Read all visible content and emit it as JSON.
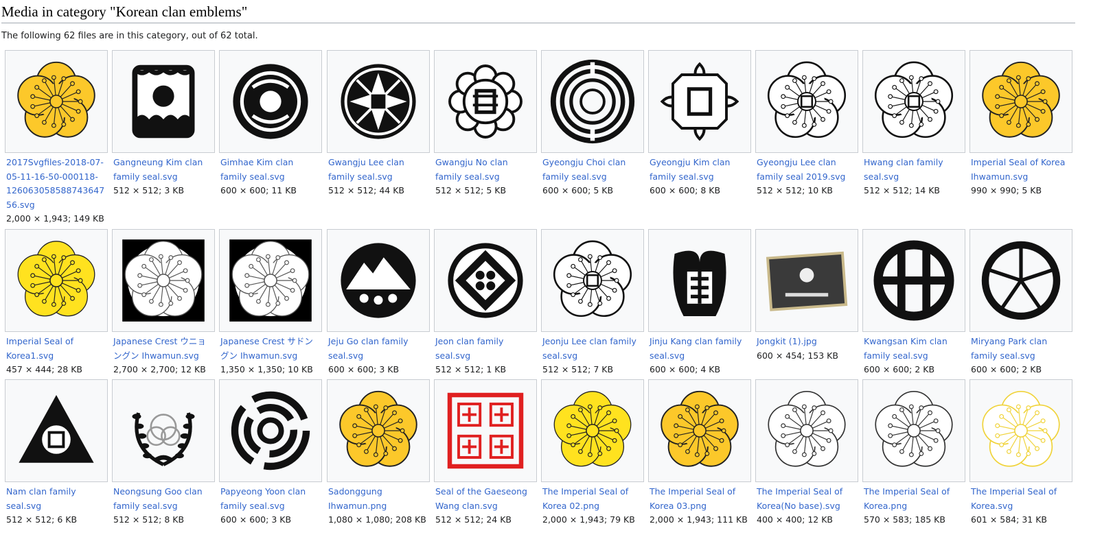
{
  "category": {
    "title": "Media in category \"Korean clan emblems\"",
    "summary": "The following 62 files are in this category, out of 62 total."
  },
  "colors": {
    "link": "#3366cc",
    "gold": "#fcc82a",
    "yellow": "#ffe21f",
    "red": "#e02020"
  },
  "files": [
    {
      "name": "2017Svgfiles-2018-07-05-11-16-50-000118-126063058588743647 56.svg",
      "display": "2017Svgfiles-2018-07-05-11-16-50-000118-12606305858874364756.svg",
      "meta": "2,000 × 1,943; 149 KB",
      "icon": "gold-plum-blossom"
    },
    {
      "name": "Gangneung Kim clan family seal.svg",
      "meta": "512 × 512; 3 KB",
      "icon": "sun-over-waves"
    },
    {
      "name": "Gimhae Kim clan family seal.svg",
      "meta": "600 × 600; 11 KB",
      "icon": "twin-fish-circle"
    },
    {
      "name": "Gwangju Lee clan family seal.svg",
      "meta": "512 × 512; 44 KB",
      "icon": "star-circle-seal"
    },
    {
      "name": "Gwangju No clan family seal.svg",
      "meta": "512 × 512; 5 KB",
      "icon": "lotus-character-seal"
    },
    {
      "name": "Gyeongju Choi clan family seal.svg",
      "meta": "600 × 600; 5 KB",
      "icon": "concentric-rings-seal"
    },
    {
      "name": "Gyeongju Kim clan family seal.svg",
      "meta": "600 × 600; 8 KB",
      "icon": "cross-character-seal"
    },
    {
      "name": "Gyeongju Lee clan family seal 2019.svg",
      "meta": "512 × 512; 10 KB",
      "icon": "outline-blossom-character"
    },
    {
      "name": "Hwang clan family seal.svg",
      "meta": "512 × 512; 14 KB",
      "icon": "outline-blossom-character"
    },
    {
      "name": "Imperial Seal of Korea Ihwamun.svg",
      "meta": "990 × 990; 5 KB",
      "icon": "gold-plum-blossom"
    },
    {
      "name": "Imperial Seal of Korea1.svg",
      "meta": "457 × 444; 28 KB",
      "icon": "yellow-plum-blossom"
    },
    {
      "name": "Japanese Crest ウニョングン Ihwamun.svg",
      "meta": "2,700 × 2,700; 12 KB",
      "icon": "black-square-blossom"
    },
    {
      "name": "Japanese Crest サドングン Ihwamun.svg",
      "meta": "1,350 × 1,350; 10 KB",
      "icon": "black-square-blossom"
    },
    {
      "name": "Jeju Go clan family seal.svg",
      "meta": "600 × 600; 3 KB",
      "icon": "mountain-circle"
    },
    {
      "name": "Jeon clan family seal.svg",
      "meta": "512 × 512; 1 KB",
      "icon": "diamond-circle"
    },
    {
      "name": "Jeonju Lee clan family seal.svg",
      "meta": "512 × 512; 7 KB",
      "icon": "outline-blossom-character"
    },
    {
      "name": "Jinju Kang clan family seal.svg",
      "meta": "600 × 600; 4 KB",
      "icon": "phoenix-character"
    },
    {
      "name": "Jongkit (1).jpg",
      "meta": "600 × 454; 153 KB",
      "icon": "flag-photo"
    },
    {
      "name": "Kwangsan Kim clan family seal.svg",
      "meta": "600 × 600; 2 KB",
      "icon": "grid-circle"
    },
    {
      "name": "Miryang Park clan family seal.svg",
      "meta": "600 × 600; 2 KB",
      "icon": "star-spoke-circle"
    },
    {
      "name": "Nam clan family seal.svg",
      "meta": "512 × 512; 6 KB",
      "icon": "triangle-character"
    },
    {
      "name": "Neongsung Goo clan family seal.svg",
      "meta": "512 × 512; 8 KB",
      "icon": "laurel-wreath"
    },
    {
      "name": "Papyeong Yoon clan family seal.svg",
      "meta": "600 × 600; 3 KB",
      "icon": "broken-rings"
    },
    {
      "name": "Sadonggung Ihwamun.png",
      "meta": "1,080 × 1,080; 208 KB",
      "icon": "gold-plum-blossom"
    },
    {
      "name": "Seal of the Gaeseong Wang clan.svg",
      "meta": "512 × 512; 24 KB",
      "icon": "red-square-seal"
    },
    {
      "name": "The Imperial Seal of Korea 02.png",
      "meta": "2,000 × 1,943; 79 KB",
      "icon": "yellow-plum-blossom"
    },
    {
      "name": "The Imperial Seal of Korea 03.png",
      "meta": "2,000 × 1,943; 111 KB",
      "icon": "gold-plum-blossom"
    },
    {
      "name": "The Imperial Seal of Korea(No base).svg",
      "meta": "400 × 400; 12 KB",
      "icon": "outline-plum-blossom"
    },
    {
      "name": "The Imperial Seal of Korea.png",
      "meta": "570 × 583; 185 KB",
      "icon": "outline-plum-blossom"
    },
    {
      "name": "The Imperial Seal of Korea.svg",
      "meta": "601 × 584; 31 KB",
      "icon": "pale-plum-blossom"
    }
  ]
}
